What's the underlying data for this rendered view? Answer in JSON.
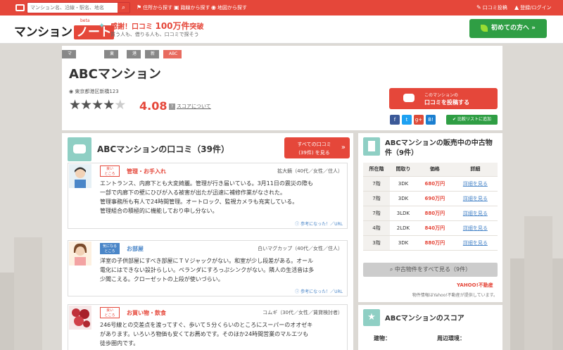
{
  "topbar": {
    "search_placeholder": "マンション名、沿線・駅名、地名",
    "links": [
      "住所から探す",
      "路線から探す",
      "地図から探す"
    ],
    "post_review": "口コミ投稿",
    "login": "登録/ログイン"
  },
  "header": {
    "brand_main": "マンション",
    "brand_note": "ノート",
    "beta": "beta",
    "banner_prefix": "感謝！口コミ",
    "banner_number": "100万件",
    "banner_suffix": "突破",
    "banner_sub": "買う人も、借りる人も、口コミで探そう",
    "beginner_button": "初めての方へ"
  },
  "breadcrumbs": [
    "マンションノート",
    "東京都",
    "港区",
    "新橋",
    "ABCマンション"
  ],
  "property": {
    "name": "ABCマンション",
    "address": "東京都港区新橋123",
    "rating_stars": 4,
    "rating_max": 5,
    "score": "4.08",
    "score_link": "スコアについて",
    "post_line1": "このマンションの",
    "post_line2": "口コミを投稿する",
    "share": [
      "f",
      "t",
      "g+",
      "B!"
    ],
    "favorite": "比較リストに追加"
  },
  "reviews_panel": {
    "title": "ABCマンションの口コミ（39件）",
    "all_line1": "すべての口コミ",
    "all_line2": "(39件) を見る",
    "reviews": [
      {
        "tag_top": "良い",
        "tag_bottom": "ところ",
        "category": "管理・お手入れ",
        "author": "拡大鏡（40代／女性／住人）",
        "lines": [
          "エントランス、内廊下とも大変綺麗。管理が行き届いている。3月11日の震災の際も",
          "一部で内廊下の壁にひびが入る被害が出たが迅速に補修作業がなされた。",
          "管理事務所も有人で24時間管理。オートロック、監視カメラも充実している。",
          "管理組合の積極的に機能しており申し分ない。"
        ],
        "helpful": "参考になった！／URL"
      },
      {
        "tag_top": "気になる",
        "tag_bottom": "ところ",
        "category": "お部屋",
        "author": "白いマグカップ（40代／女性／住人）",
        "lines": [
          "洋室の子供部屋にすべき部屋にＴＶジャックがない。和室が少し段差がある。オール",
          "電化にはできない設計らしい。ベランダにすろっぷシンクがない。隣人の生活音は多",
          "少聞こえる。クローゼットの上段が使いづらい。"
        ],
        "helpful": "参考になった！／URL"
      },
      {
        "tag_top": "良い",
        "tag_bottom": "ところ",
        "category": "お買い物・飲食",
        "author": "コムギ（30代／女性／賃貸検討者）",
        "lines": [
          "246号線との交差点を渡ってすぐ、歩いて５分くらいのところにスーパーのオオゼキ",
          "があります。いろいろ物価も安くてお薦めです。そのほか24時間営業のマルエツも",
          "徒歩圏内です。"
        ],
        "helpful": "参考になった！／URL"
      }
    ]
  },
  "sale_panel": {
    "title": "ABCマンションの販売中の中古物件（9件）",
    "headers": [
      "所在階",
      "間取り",
      "価格",
      "詳細"
    ],
    "rows": [
      {
        "floor": "7階",
        "layout": "3DK",
        "price": "680万円",
        "detail": "詳細を見る"
      },
      {
        "floor": "7階",
        "layout": "3DK",
        "price": "690万円",
        "detail": "詳細を見る"
      },
      {
        "floor": "7階",
        "layout": "3LDK",
        "price": "880万円",
        "detail": "詳細を見る"
      },
      {
        "floor": "4階",
        "layout": "2LDK",
        "price": "840万円",
        "detail": "詳細を見る"
      },
      {
        "floor": "3階",
        "layout": "3DK",
        "price": "880万円",
        "detail": "詳細を見る"
      }
    ],
    "see_all": "中古物件をすべて見る（9件）",
    "yahoo": "YAHOO!不動産",
    "note": "物件情報はYahoo!不動産が提供しています。"
  },
  "score_panel": {
    "title": "ABCマンションのスコア",
    "building_label": "建物：",
    "area_label": "周辺環境："
  },
  "colors": {
    "accent": "#e5473a",
    "green": "#2f9e44",
    "teal": "#8fcfc4",
    "link": "#4a86c8"
  }
}
